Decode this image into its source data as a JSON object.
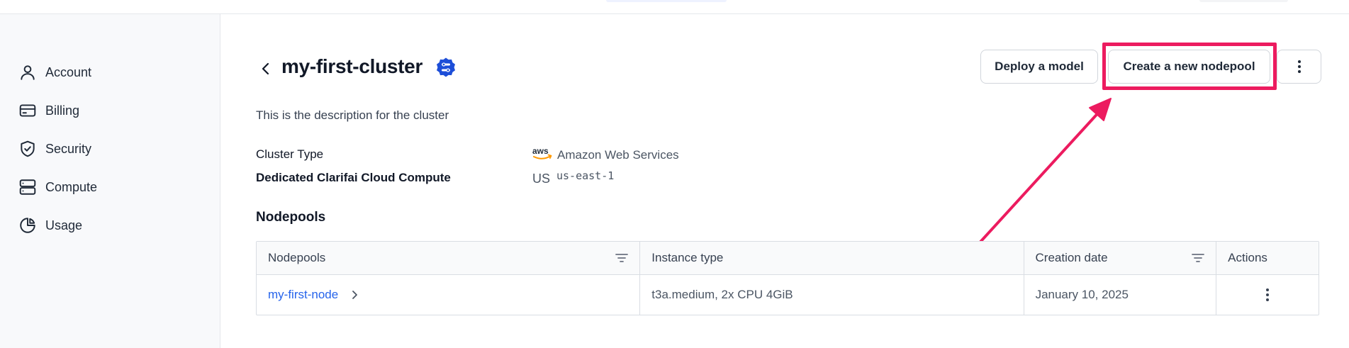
{
  "sidebar": {
    "items": [
      {
        "label": "Account",
        "icon": "user-icon"
      },
      {
        "label": "Billing",
        "icon": "credit-card-icon"
      },
      {
        "label": "Security",
        "icon": "shield-check-icon"
      },
      {
        "label": "Compute",
        "icon": "server-icon"
      },
      {
        "label": "Usage",
        "icon": "pie-chart-icon"
      }
    ]
  },
  "header": {
    "title": "my-first-cluster",
    "buttons": {
      "deploy": "Deploy a model",
      "create": "Create a new nodepool"
    }
  },
  "cluster": {
    "description": "This is the description for the cluster",
    "type_label": "Cluster Type",
    "type_value": "Amazon Web Services",
    "aws_logo_text": "aws",
    "compute_label": "Dedicated Clarifai Cloud Compute",
    "region_code": "US",
    "region_value": "us-east-1"
  },
  "nodepools": {
    "section_title": "Nodepools",
    "columns": [
      "Nodepools",
      "Instance type",
      "Creation date",
      "Actions"
    ],
    "rows": [
      {
        "name": "my-first-node",
        "instance_type": "t3a.medium, 2x CPU 4GiB",
        "creation_date": "January 10, 2025"
      }
    ]
  },
  "colors": {
    "accent": "#2563eb",
    "highlight": "#ec1b5f",
    "verified_badge": "#1d4ed8"
  }
}
